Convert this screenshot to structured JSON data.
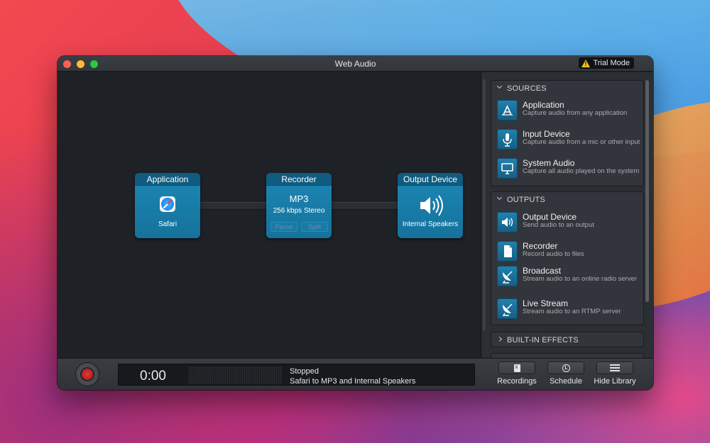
{
  "window": {
    "title": "Web Audio",
    "badge": "Trial Mode"
  },
  "pipeline": {
    "source": {
      "title": "Application",
      "label": "Safari",
      "icon": "safari-icon"
    },
    "recorder": {
      "title": "Recorder",
      "format": "MP3",
      "quality": "256 kbps Stereo",
      "pause_label": "Pause",
      "split_label": "Split"
    },
    "output": {
      "title": "Output Device",
      "label": "Internal Speakers",
      "icon": "speaker-icon"
    }
  },
  "library": {
    "sources": {
      "header": "SOURCES",
      "items": [
        {
          "title": "Application",
          "desc": "Capture audio from any application",
          "icon": "app-store-icon"
        },
        {
          "title": "Input Device",
          "desc": "Capture audio from a mic or other input",
          "icon": "microphone-icon"
        },
        {
          "title": "System Audio",
          "desc": "Capture all audio played on the system",
          "icon": "monitor-icon"
        }
      ]
    },
    "outputs": {
      "header": "OUTPUTS",
      "items": [
        {
          "title": "Output Device",
          "desc": "Send audio to an output",
          "icon": "speaker-icon"
        },
        {
          "title": "Recorder",
          "desc": "Record audio to files",
          "icon": "document-icon"
        },
        {
          "title": "Broadcast",
          "desc": "Stream audio to an online radio server",
          "icon": "satellite-dish-icon"
        },
        {
          "title": "Live Stream",
          "desc": "Stream audio to an RTMP server",
          "icon": "satellite-dish-icon"
        }
      ]
    },
    "effects": {
      "header": "BUILT-IN EFFECTS"
    }
  },
  "status": {
    "timer": "0:00",
    "state": "Stopped",
    "detail": "Safari to MP3 and Internal Speakers"
  },
  "toolbar": {
    "recordings_label": "Recordings",
    "schedule_label": "Schedule",
    "hide_library_label": "Hide Library"
  },
  "colors": {
    "accent": "#1a7ba8",
    "record": "#c91d1d"
  }
}
